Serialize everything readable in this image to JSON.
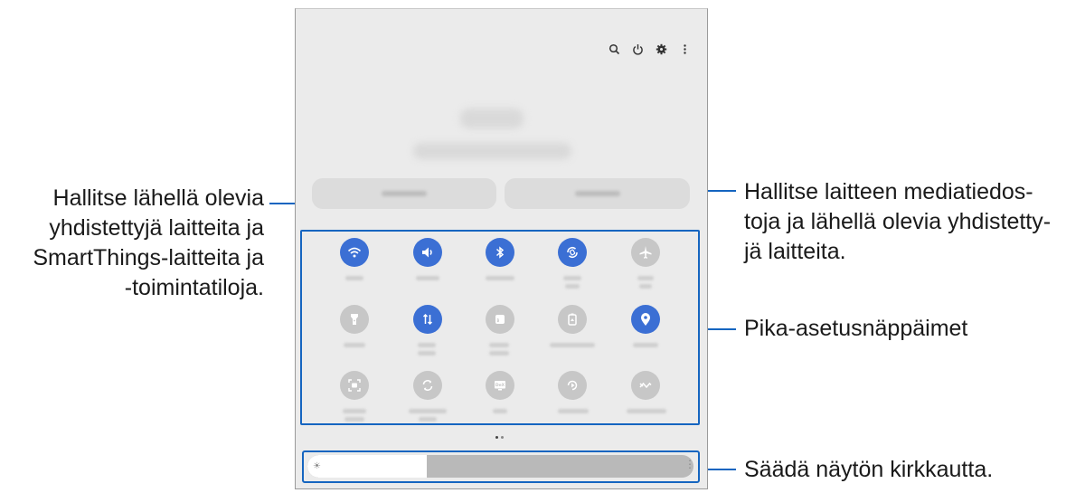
{
  "callouts": {
    "connected_devices": [
      "Hallitse lähellä olevia",
      "yhdistettyjä laitteita ja",
      "SmartThings-laitteita ja",
      "-toimintatiloja."
    ],
    "media_output": [
      "Hallitse laitteen mediatiedos-",
      "toja ja lähellä olevia yhdistetty-",
      "jä laitteita."
    ],
    "quick_settings": [
      "Pika-asetusnäppäimet"
    ],
    "brightness": [
      "Säädä näytön kirkkautta."
    ]
  },
  "quick_panel": {
    "top_icons": [
      "search-icon",
      "power-icon",
      "gear-icon",
      "more-options-icon"
    ],
    "tiles": [
      {
        "name": "wifi",
        "icon": "wifi-icon",
        "state": "on"
      },
      {
        "name": "sound",
        "icon": "sound-icon",
        "state": "on"
      },
      {
        "name": "bluetooth",
        "icon": "bluetooth-icon",
        "state": "on"
      },
      {
        "name": "auto-rotate",
        "icon": "auto-rotate-icon",
        "state": "on"
      },
      {
        "name": "airplane-mode",
        "icon": "airplane-icon",
        "state": "off"
      },
      {
        "name": "flashlight",
        "icon": "flashlight-icon",
        "state": "off"
      },
      {
        "name": "mobile-data",
        "icon": "mobile-data-icon",
        "state": "on"
      },
      {
        "name": "hotspot",
        "icon": "hotspot-icon",
        "state": "off"
      },
      {
        "name": "power-saving",
        "icon": "battery-icon",
        "state": "off"
      },
      {
        "name": "location",
        "icon": "location-icon",
        "state": "on"
      },
      {
        "name": "screen-recorder",
        "icon": "screen-recorder-icon",
        "state": "off"
      },
      {
        "name": "sync",
        "icon": "sync-icon",
        "state": "off"
      },
      {
        "name": "dex",
        "icon": "dex-icon",
        "state": "off"
      },
      {
        "name": "smart-view",
        "icon": "smart-view-icon",
        "state": "off"
      },
      {
        "name": "nearby-share",
        "icon": "nearby-share-icon",
        "state": "off"
      }
    ],
    "page_indicator": {
      "pages": 2,
      "current": 1
    },
    "brightness_level": 0.31
  },
  "colors": {
    "callout_line": "#1565c0",
    "tile_on": "#3b6fd4",
    "tile_off": "#c7c7c7",
    "panel_bg": "#ebebeb"
  }
}
